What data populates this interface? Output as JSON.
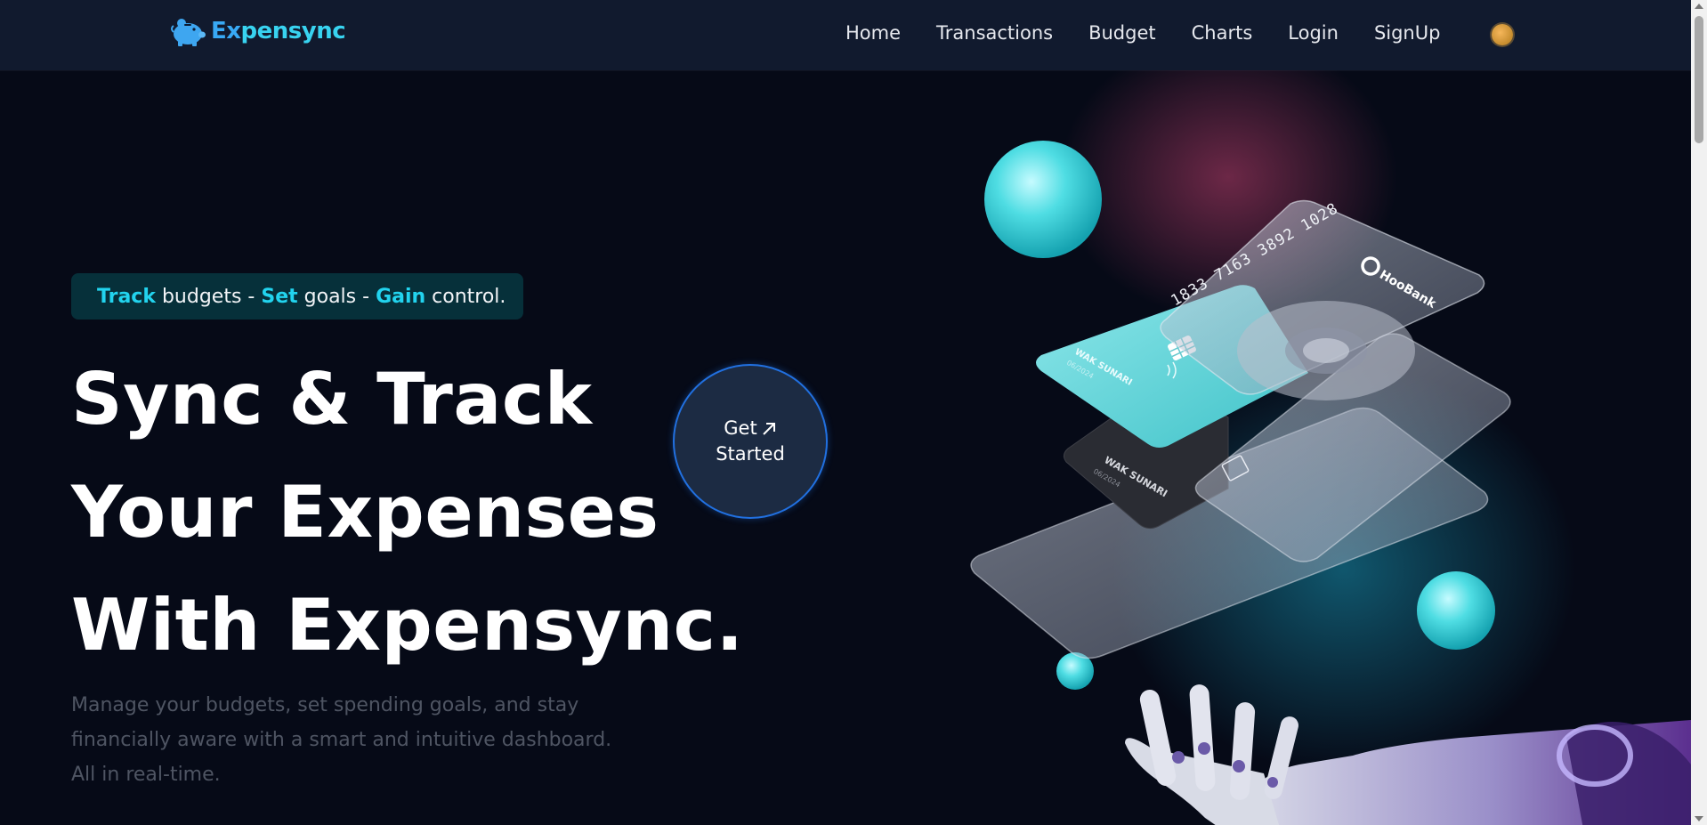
{
  "nav": {
    "brand": {
      "name_part1": "Ex",
      "name_part2": "pensync",
      "icon": "piggy-bank-icon"
    },
    "links": [
      "Home",
      "Transactions",
      "Budget",
      "Charts",
      "Login",
      "SignUp"
    ],
    "theme_toggle_icon": "sun-icon"
  },
  "hero": {
    "tagline": {
      "word1": "Track",
      "text1": " budgets - ",
      "word2": "Set",
      "text2": " goals - ",
      "word3": "Gain",
      "text3": " control."
    },
    "title_lines": [
      "Sync & Track",
      "Your Expenses",
      "With Expensync."
    ],
    "description": "Manage your budgets, set spending goals, and stay financially aware with a smart and intuitive dashboard. All in real-time.",
    "cta": {
      "line1": "Get",
      "line2": "Started",
      "icon": "arrow-up-right-icon"
    }
  },
  "illustration": {
    "card_number": "1833 7163 3892 1028",
    "bank_name": "HooBank",
    "cardholder": "WAK SUNARI",
    "expiry": "06/2024"
  },
  "colors": {
    "accent": "#22d3ee",
    "background": "#060a17",
    "nav_background": "#111a2e",
    "cta_border": "#2170e0"
  }
}
